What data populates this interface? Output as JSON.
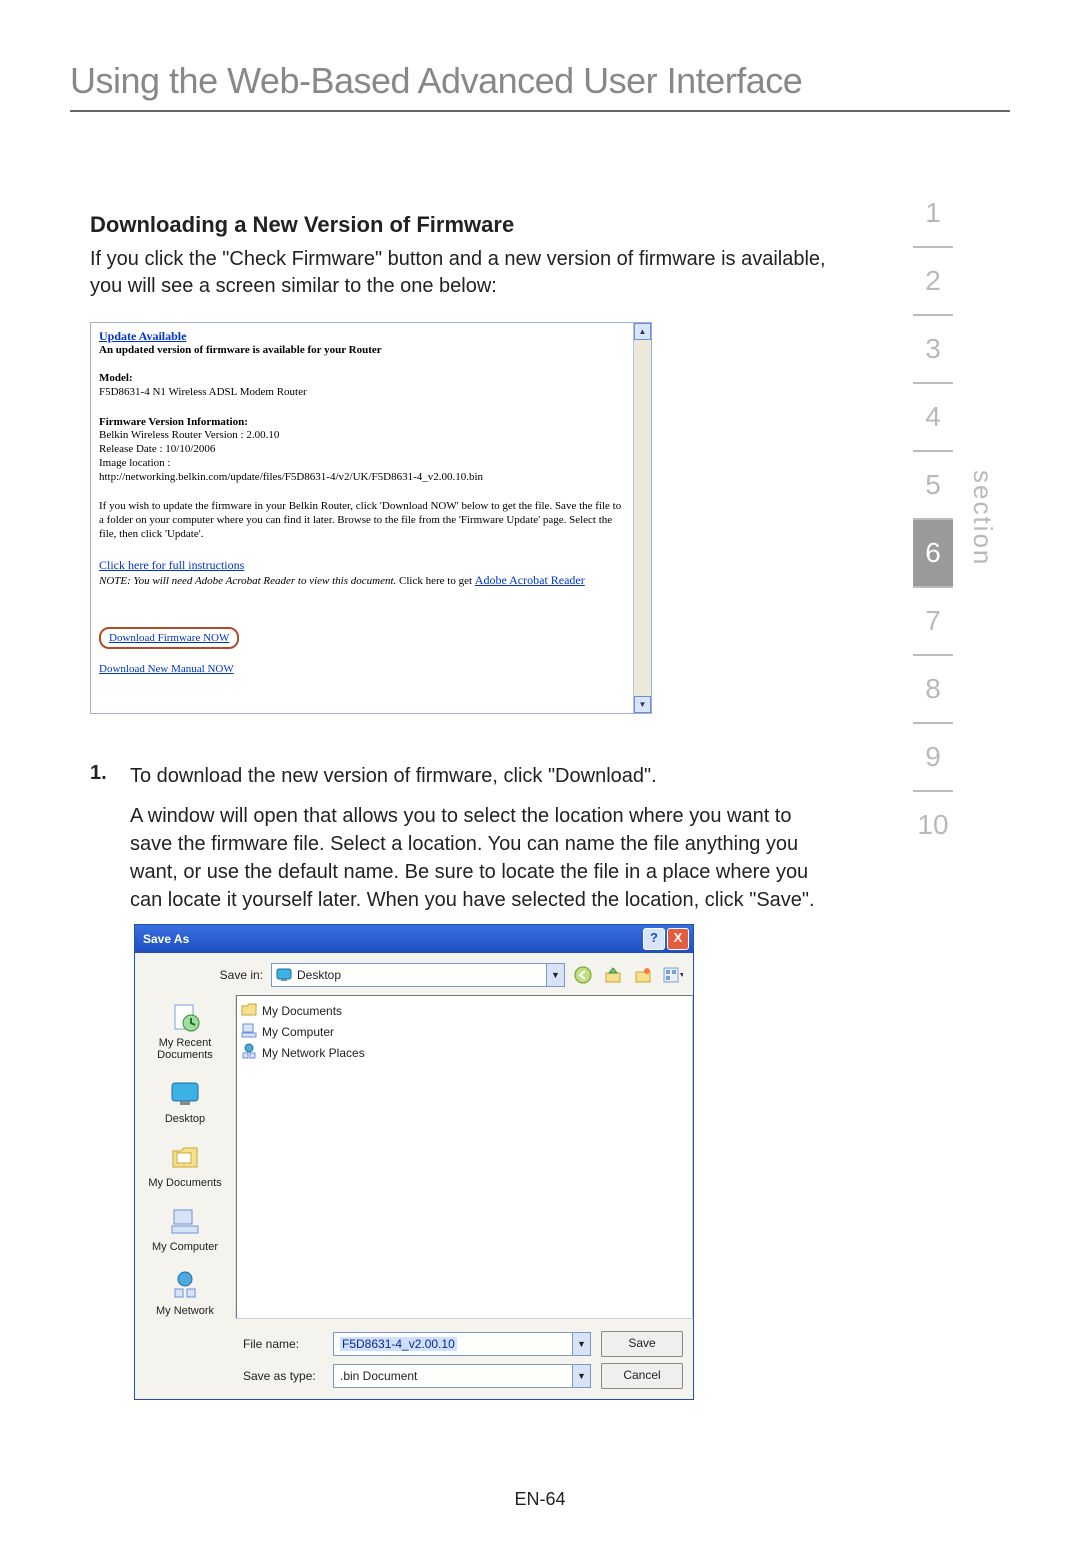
{
  "page_title": "Using the Web-Based Advanced User Interface",
  "section_heading": "Downloading a New Version of Firmware",
  "intro_paragraph": "If you click the \"Check Firmware\" button and a new version of firmware is available, you will see a screen similar to the one below:",
  "update_box": {
    "update_available_link": "Update Available",
    "update_available_sub": "An updated version of firmware is available for your Router",
    "model_label": "Model:",
    "model_value": "F5D8631-4 N1 Wireless ADSL Modem Router",
    "fw_info_label": "Firmware Version Information:",
    "fw_version": "Belkin Wireless Router Version : 2.00.10",
    "fw_release": "Release Date : 10/10/2006",
    "fw_imgloc_label": "Image location :",
    "fw_imgloc_url": "http://networking.belkin.com/update/files/F5D8631-4/v2/UK/F5D8631-4_v2.00.10.bin",
    "instructions_para": "If you wish to update the firmware in your Belkin Router, click 'Download NOW' below to get the file. Save the file to a folder on your computer where you can find it later. Browse to the file from the 'Firmware Update' page. Select the file, then click 'Update'.",
    "full_instructions_link": "Click here for full instructions",
    "note_line_prefix": "NOTE: You will need Adobe Acrobat Reader to view this document.",
    "note_link_text": " Click here to get ",
    "adobe_link": "Adobe Acrobat Reader",
    "download_fw_btn": "Download Firmware NOW",
    "download_manual_link": "Download New Manual NOW"
  },
  "step1": {
    "num": "1.",
    "line1": "To download the new version of firmware, click \"Download\".",
    "line2": "A window will open that allows you to select the location where you want to save the firmware file. Select a location. You can name the file anything you want, or use the default name. Be sure to locate the file in a place where you can locate it yourself later. When you have selected the location, click \"Save\"."
  },
  "saveas_dialog": {
    "title": "Save As",
    "help_btn": "?",
    "close_btn": "X",
    "savein_label": "Save in:",
    "savein_value": "Desktop",
    "nav_icons": [
      "back-icon",
      "up-icon",
      "new-folder-icon",
      "views-icon"
    ],
    "places": [
      {
        "icon": "recent-docs-icon",
        "label": "My Recent Documents"
      },
      {
        "icon": "desktop-icon",
        "label": "Desktop"
      },
      {
        "icon": "my-documents-icon",
        "label": "My Documents"
      },
      {
        "icon": "my-computer-icon",
        "label": "My Computer"
      },
      {
        "icon": "my-network-icon",
        "label": "My Network"
      }
    ],
    "file_list": [
      {
        "icon": "folder-icon",
        "label": "My Documents"
      },
      {
        "icon": "my-computer-icon",
        "label": "My Computer"
      },
      {
        "icon": "my-network-icon",
        "label": "My Network Places"
      }
    ],
    "filename_label": "File name:",
    "filename_value": "F5D8631-4_v2.00.10",
    "saveastype_label": "Save as type:",
    "saveastype_value": ".bin Document",
    "save_btn": "Save",
    "cancel_btn": "Cancel"
  },
  "section_nav": {
    "items": [
      "1",
      "2",
      "3",
      "4",
      "5",
      "6",
      "7",
      "8",
      "9",
      "10"
    ],
    "active_index": 5,
    "label": "section"
  },
  "page_number": "EN-64"
}
